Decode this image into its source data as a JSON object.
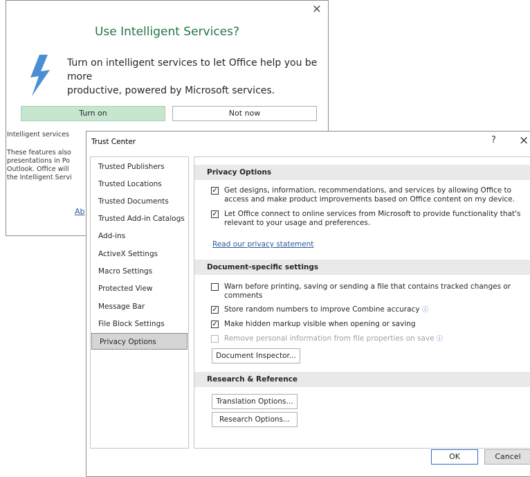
{
  "intelligent_dialog": {
    "close_glyph": "×",
    "title": "Use Intelligent Services?",
    "lead_line1": "Turn on intelligent services to let Office help you be more",
    "lead_line2": "productive, powered by Microsoft services.",
    "turn_on_label": "Turn on",
    "not_now_label": "Not now",
    "line_services": "Intelligent services",
    "line_features": "These features also",
    "line_presentations": "presentations in Po",
    "line_outlook": "Outlook. Office will",
    "line_intelligent": "the Intelligent Servi",
    "about_link": "Ab",
    "icon": "lightning-bolt-icon",
    "accent_color": "#217346",
    "bolt_color": "#4a8fd4"
  },
  "trust_center": {
    "title": "Trust Center",
    "help_glyph": "?",
    "close_glyph": "×",
    "nav": [
      {
        "label": "Trusted Publishers"
      },
      {
        "label": "Trusted Locations"
      },
      {
        "label": "Trusted Documents"
      },
      {
        "label": "Trusted Add-in Catalogs"
      },
      {
        "label": "Add-ins"
      },
      {
        "label": "ActiveX Settings"
      },
      {
        "label": "Macro Settings"
      },
      {
        "label": "Protected View"
      },
      {
        "label": "Message Bar"
      },
      {
        "label": "File Block Settings"
      },
      {
        "label": "Privacy Options"
      }
    ],
    "selected_nav": "Privacy Options",
    "privacy": {
      "header": "Privacy Options",
      "opt1": "Get designs, information, recommendations, and services by allowing Office to access and make product improvements based on Office content on my device.",
      "opt1_checked": true,
      "opt2": "Let Office connect to online services from Microsoft to provide functionality that's relevant to your usage and preferences.",
      "opt2_checked": true,
      "privacy_link": "Read our privacy statement"
    },
    "document": {
      "header": "Document-specific settings",
      "opt1": "Warn before printing, saving or sending a file that contains tracked changes or comments",
      "opt1_checked": false,
      "opt2": "Store random numbers to improve Combine accuracy",
      "opt2_checked": true,
      "opt3": "Make hidden markup visible when opening or saving",
      "opt3_checked": true,
      "opt4": "Remove personal information from file properties on save",
      "opt4_checked": false,
      "info_glyph": "ⓘ",
      "inspector_button": "Document Inspector..."
    },
    "research": {
      "header": "Research & Reference",
      "translation_button": "Translation Options...",
      "research_button": "Research Options..."
    },
    "ok_label": "OK",
    "cancel_label": "Cancel",
    "check_glyph": "✓"
  }
}
